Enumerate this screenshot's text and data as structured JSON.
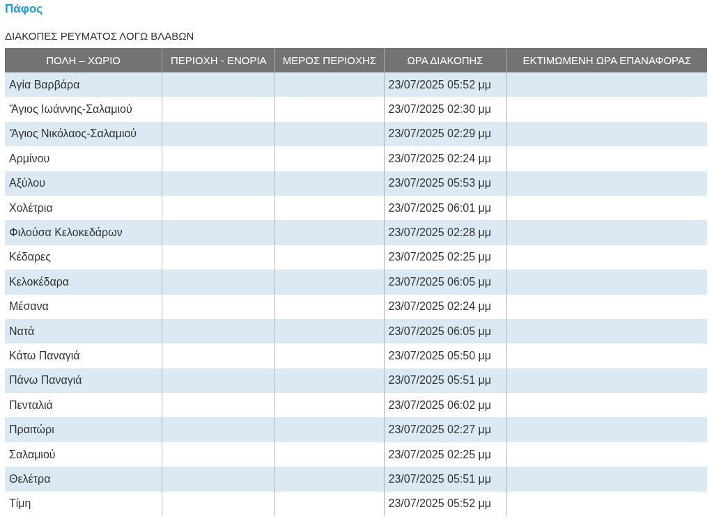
{
  "region_title": "Πάφος",
  "heading": "ΔΙΑΚΟΠΕΣ ΡΕΥΜΑΤΟΣ ΛΟΓΩ ΒΛΑΒΩΝ",
  "table": {
    "columns": [
      "ΠΟΛΗ – ΧΩΡΙΟ",
      "ΠΕΡΙΟΧΗ - ΕΝΟΡΙΑ",
      "ΜΕΡΟΣ ΠΕΡΙΟΧΗΣ",
      "ΩΡΑ ΔΙΑΚΟΠΗΣ",
      "ΕΚΤΙΜΩΜΕΝΗ ΩΡΑ ΕΠΑΝΑΦΟΡΑΣ"
    ],
    "rows": [
      {
        "place": "Αγία Βαρβάρα",
        "outage_time": "23/07/2025 05:52 μμ"
      },
      {
        "place": "'Άγιος Ιωάννης-Σαλαμιού",
        "outage_time": "23/07/2025 02:30 μμ"
      },
      {
        "place": "'Άγιος Νικόλαος-Σαλαμιού",
        "outage_time": "23/07/2025 02:29 μμ"
      },
      {
        "place": "Αρμίνου",
        "outage_time": "23/07/2025 02:24 μμ"
      },
      {
        "place": "Αξύλου",
        "outage_time": "23/07/2025 05:53 μμ"
      },
      {
        "place": "Χολέτρια",
        "outage_time": "23/07/2025 06:01 μμ"
      },
      {
        "place": "Φιλούσα Κελοκεδάρων",
        "outage_time": "23/07/2025 02:28 μμ"
      },
      {
        "place": "Κέδαρες",
        "outage_time": "23/07/2025 02:25 μμ"
      },
      {
        "place": "Κελοκέδαρα",
        "outage_time": "23/07/2025 06:05 μμ"
      },
      {
        "place": "Μέσανα",
        "outage_time": "23/07/2025 02:24 μμ"
      },
      {
        "place": "Νατά",
        "outage_time": "23/07/2025 06:05 μμ"
      },
      {
        "place": "Κάτω Παναγιά",
        "outage_time": "23/07/2025 05:50 μμ"
      },
      {
        "place": "Πάνω Παναγιά",
        "outage_time": "23/07/2025 05:51 μμ"
      },
      {
        "place": "Πενταλιά",
        "outage_time": "23/07/2025 06:02 μμ"
      },
      {
        "place": "Πραιτώρι",
        "outage_time": "23/07/2025 02:27 μμ"
      },
      {
        "place": "Σαλαμιού",
        "outage_time": "23/07/2025 02:25 μμ"
      },
      {
        "place": "Θελέτρα",
        "outage_time": "23/07/2025 05:51 μμ"
      },
      {
        "place": "Τίμη",
        "outage_time": "23/07/2025 05:52 μμ"
      }
    ]
  }
}
